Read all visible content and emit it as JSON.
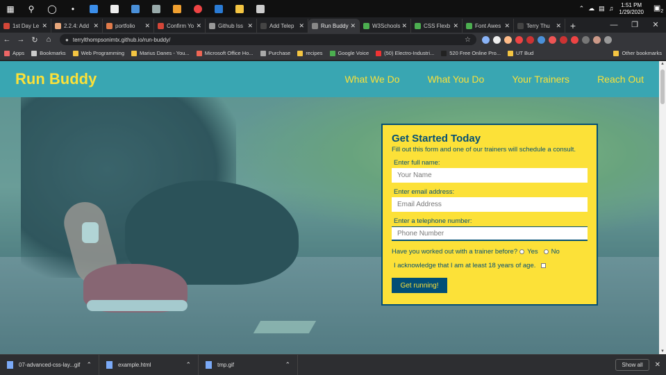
{
  "taskbar": {
    "clock_time": "1:51 PM",
    "clock_date": "1/29/2020",
    "notification_count": "2"
  },
  "tabs": [
    {
      "label": "1st Day Le",
      "color": "#d44638"
    },
    {
      "label": "2.2.4: Add",
      "color": "#e8a87c"
    },
    {
      "label": "portfolio",
      "color": "#e07a4a"
    },
    {
      "label": "Confirm Yo",
      "color": "#d44638"
    },
    {
      "label": "Github Iss",
      "color": "#999999"
    },
    {
      "label": "Add Telep",
      "color": "#444444"
    },
    {
      "label": "Run Buddy",
      "color": "#888888"
    },
    {
      "label": "W3Schools",
      "color": "#4caf50"
    },
    {
      "label": "CSS Flexb",
      "color": "#4caf50"
    },
    {
      "label": "Font Awes",
      "color": "#4caf50"
    },
    {
      "label": "Terry Thu",
      "color": "#444444"
    }
  ],
  "address_bar": {
    "url": "terrylthompsonimtx.github.io/run-buddy/"
  },
  "bookmarks": [
    {
      "label": "Apps",
      "color": "#e66"
    },
    {
      "label": "Bookmarks",
      "color": "#ccc"
    },
    {
      "label": "Web Programming",
      "color": "#f4c542"
    },
    {
      "label": "Marius Danes - You...",
      "color": "#f4c542"
    },
    {
      "label": "Microsoft Office Ho...",
      "color": "#e65"
    },
    {
      "label": "Purchase",
      "color": "#aaa"
    },
    {
      "label": "recipes",
      "color": "#f4c542"
    },
    {
      "label": "Google Voice",
      "color": "#4caf50"
    },
    {
      "label": "(50) Electro-Industri...",
      "color": "#e33"
    },
    {
      "label": "520 Free Online Pro...",
      "color": "#222"
    },
    {
      "label": "UT Bud",
      "color": "#f4c542"
    }
  ],
  "bookmarks_other": "Other bookmarks",
  "site": {
    "logo": "Run Buddy",
    "nav": [
      "What We Do",
      "What You Do",
      "Your Trainers",
      "Reach Out"
    ]
  },
  "form": {
    "title": "Get Started Today",
    "subtitle": "Fill out this form and one of our trainers will schedule a consult.",
    "name_label": "Enter full name:",
    "name_placeholder": "Your Name",
    "email_label": "Enter email address:",
    "email_placeholder": "Email Address",
    "phone_label": "Enter a telephone number:",
    "phone_placeholder": "Phone Number",
    "trainer_question": "Have you worked out with a trainer before?",
    "yes_label": "Yes",
    "no_label": "No",
    "age_ack": "I acknowledge that I am at least 18 years of age.",
    "submit_label": "Get running!"
  },
  "downloads": [
    {
      "name": "07-advanced-css-lay...gif"
    },
    {
      "name": "example.html"
    },
    {
      "name": "tmp.gif"
    }
  ],
  "downloads_show_all": "Show all"
}
